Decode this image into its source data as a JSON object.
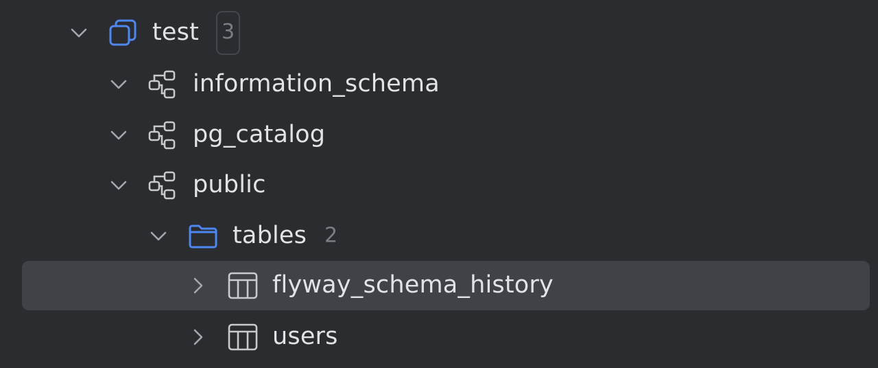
{
  "colors": {
    "background": "#2b2c30",
    "selection": "#414247",
    "accent_icon": "#4f87f0",
    "text": "#e2e3e7",
    "muted": "#7c7d83"
  },
  "tree": {
    "database": {
      "label": "test",
      "count": "3",
      "icon": "database-icon",
      "expanded": true
    },
    "schemas": [
      {
        "label": "information_schema",
        "icon": "schema-icon",
        "expanded": true
      },
      {
        "label": "pg_catalog",
        "icon": "schema-icon",
        "expanded": true
      },
      {
        "label": "public",
        "icon": "schema-icon",
        "expanded": true
      }
    ],
    "folder": {
      "label": "tables",
      "count": "2",
      "icon": "folder-icon",
      "expanded": true
    },
    "tables": [
      {
        "label": "flyway_schema_history",
        "icon": "table-icon",
        "expanded": false,
        "selected": true
      },
      {
        "label": "users",
        "icon": "table-icon",
        "expanded": false,
        "selected": false
      }
    ]
  }
}
